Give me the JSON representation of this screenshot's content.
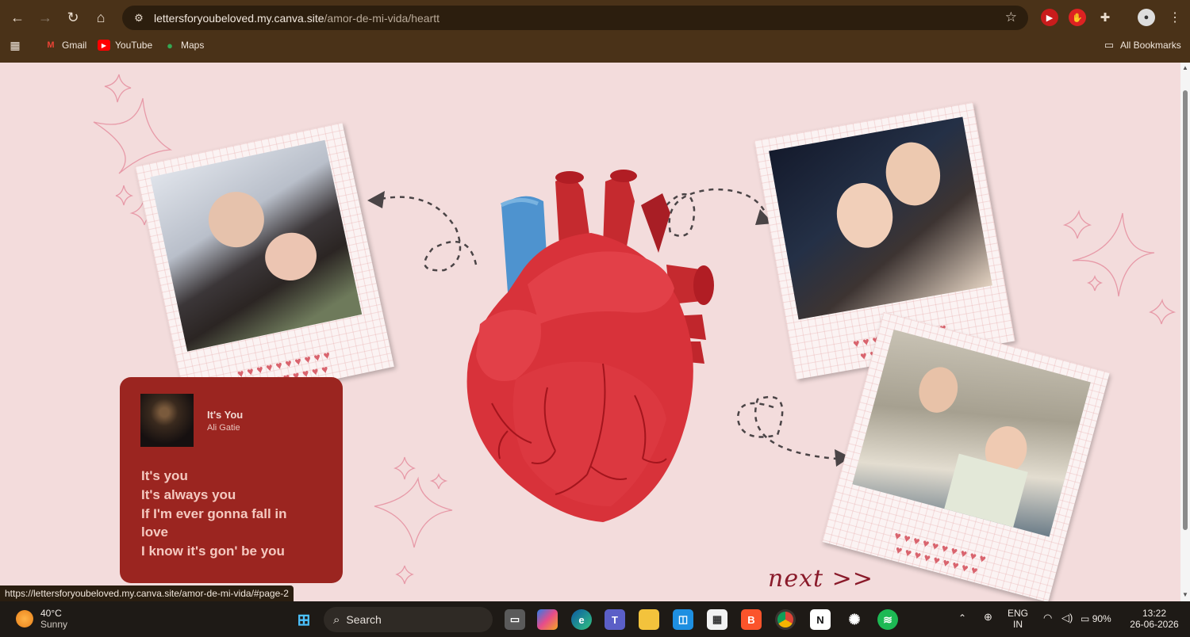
{
  "browser": {
    "url_host": "lettersforyoubeloved.my.canva.site",
    "url_path": "/amor-de-mi-vida/heartt",
    "bookmarks": [
      {
        "label": "Gmail",
        "icon": "gmail-icon",
        "color": "#ea4335"
      },
      {
        "label": "YouTube",
        "icon": "youtube-icon",
        "color": "#ff0000"
      },
      {
        "label": "Maps",
        "icon": "maps-icon",
        "color": "#34a853"
      }
    ],
    "all_bookmarks_label": "All Bookmarks"
  },
  "page": {
    "music_card": {
      "song_title": "It's You",
      "artist": "Ali Gatie",
      "lyrics": [
        "It's you",
        "It's always you",
        "If I'm ever gonna fall in",
        "love",
        "I know it's gon' be you"
      ]
    },
    "next_label": "next >>",
    "status_url": "https://lettersforyoubeloved.my.canva.site/amor-de-mi-vida/#page-2",
    "colors": {
      "background": "#f3dcdc",
      "card": "#9b2520",
      "heart": "#d8323a",
      "accent_text": "#8a1a2a"
    }
  },
  "taskbar": {
    "weather_temp": "40°C",
    "weather_desc": "Sunny",
    "search_label": "Search",
    "language": "ENG",
    "region": "IN",
    "battery": "90%",
    "time": "13:22",
    "date": "26-06-2026"
  }
}
